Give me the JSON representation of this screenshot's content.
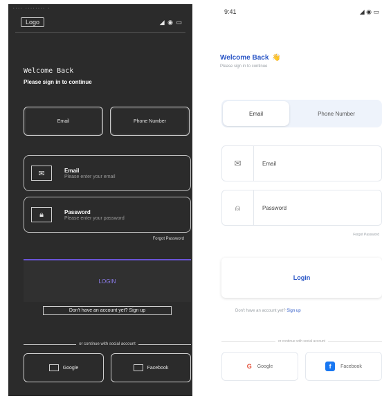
{
  "dark": {
    "status_strip": "···· ········ ·",
    "brand": "Logo",
    "status_icons": "◢ ◉ ▭",
    "title": "Welcome Back",
    "subtitle": "Please sign in to continue",
    "seg_left": "Email",
    "seg_right": "Phone Number",
    "email_label": "Email",
    "email_hint": "Please enter your email",
    "password_label": "Password",
    "password_hint": "Please enter your password",
    "forgot": "Forgot Password",
    "login": "LOGIN",
    "signup": "Don't have an account yet? Sign up",
    "or": "or continue with social account",
    "google": "Google",
    "facebook": "Facebook"
  },
  "light": {
    "time": "9:41",
    "status_icons": "◢ ◉ ▭",
    "welcome": "Welcome Back",
    "welcome_emoji": "👋",
    "sub": "Please sign in to continue",
    "seg_left": "Email",
    "seg_right": "Phone Number",
    "email": "Email",
    "password": "Password",
    "forgot": "Forgot Password",
    "login": "Login",
    "signup_text": "Don't have an account yet? ",
    "signup_link": "Sign up",
    "or": "or continue with social account",
    "google": "Google",
    "facebook": "Facebook"
  }
}
